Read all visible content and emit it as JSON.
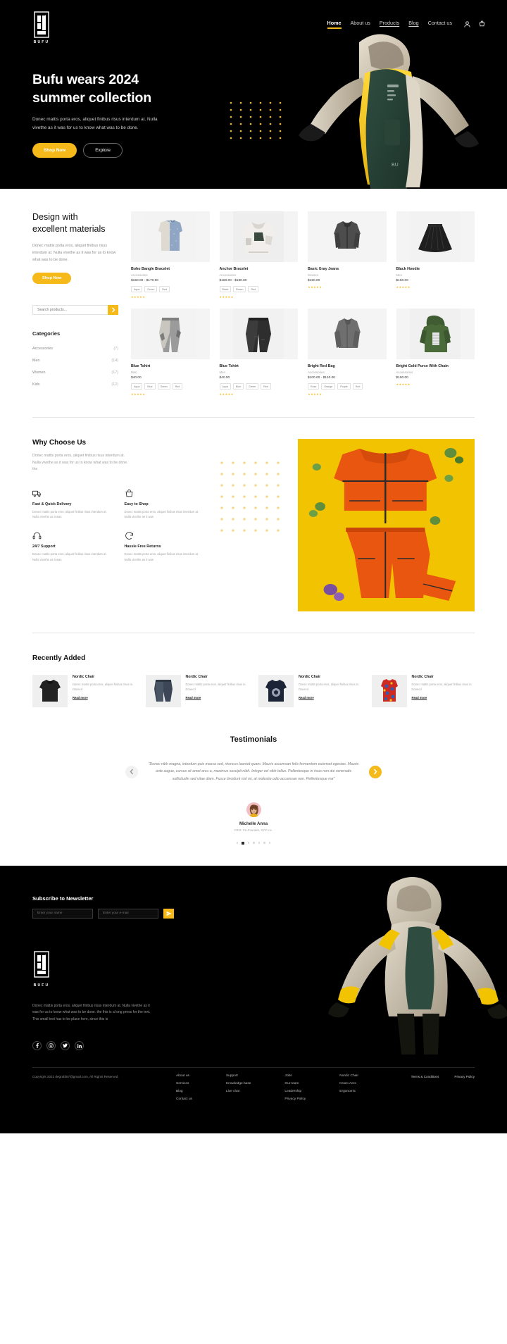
{
  "brand": {
    "name": "BUFU",
    "logo_icon": "bufu-monogram-logo"
  },
  "colors": {
    "accent": "#F5B919",
    "dark": "#000000",
    "muted": "#9a9a9a"
  },
  "nav": {
    "links": [
      {
        "label": "Home",
        "state": "active"
      },
      {
        "label": "About us",
        "state": "default"
      },
      {
        "label": "Products",
        "state": "underlined"
      },
      {
        "label": "Blog",
        "state": "underlined"
      },
      {
        "label": "Contact us",
        "state": "default"
      }
    ],
    "icons": [
      {
        "name": "user-account-icon"
      },
      {
        "name": "shopping-cart-icon"
      }
    ]
  },
  "hero": {
    "title_line1": "Bufu wears 2024",
    "title_line2": "summer collection",
    "subtitle": "Donec mattis porta eros, aliquet finibus risus interdum at. Nulla vivethe as it was for us to know what was to be done.",
    "primary_button": "Shop Now",
    "secondary_button": "Explore",
    "art_icon": "model-wearing-green-yellow-hooded-vest"
  },
  "design": {
    "title_line1": "Design with",
    "title_line2": "excellent materials",
    "copy": "Donec mattis porta eros, aliquet finibus risus interdum at. Nulla vivethe as it was for us to know what was to be done.",
    "shop_button": "Shop Now",
    "search_placeholder": "Search products...",
    "search_value": "",
    "search_icon": "chevron-right-icon",
    "categories_title": "Categories",
    "categories": [
      {
        "label": "Accessories",
        "count": "(7)"
      },
      {
        "label": "Men",
        "count": "(14)"
      },
      {
        "label": "Women",
        "count": "(17)"
      },
      {
        "label": "Kids",
        "count": "(12)"
      }
    ]
  },
  "products": [
    {
      "name": "Boho Bangle Bracelet",
      "category": "Accessories",
      "price": "$150.00 - $170.00",
      "swatches": [
        "Aqua",
        "Green",
        "Red"
      ],
      "rating": "★★★★★",
      "image_icon": "blue-grey-sleeveless-vest"
    },
    {
      "name": "Anchor Bracelet",
      "category": "Accessories",
      "price": "$150.00 - $180.00",
      "swatches": [
        "Black",
        "Brown",
        "Red"
      ],
      "rating": "★★★★★",
      "image_icon": "white-patched-jacket"
    },
    {
      "name": "Basic Gray Jeans",
      "category": "Women",
      "price": "$150.00",
      "swatches": [],
      "rating": "★★★★★",
      "image_icon": "grey-cropped-jacket"
    },
    {
      "name": "Black Hoodie",
      "category": "Men",
      "price": "$150.00",
      "swatches": [],
      "rating": "★★★★★",
      "image_icon": "black-pleated-skirt"
    },
    {
      "name": "Blue Tshirt",
      "category": "Men",
      "price": "$40.00",
      "swatches": [
        "Aqua",
        "Blue",
        "Green",
        "Red"
      ],
      "rating": "★★★★★",
      "image_icon": "grey-cargo-pants"
    },
    {
      "name": "Blue Tshirt",
      "category": "Men",
      "price": "$40.00",
      "swatches": [
        "Aqua",
        "Blue",
        "Green",
        "Red"
      ],
      "rating": "★★★★★",
      "image_icon": "black-wide-leg-trousers"
    },
    {
      "name": "Bright Red Bag",
      "category": "Accessories",
      "price": "$100.00 - $140.00",
      "swatches": [
        "Rose",
        "Orange",
        "Purple",
        "Red"
      ],
      "rating": "★★★★★",
      "image_icon": "grey-structured-jacket"
    },
    {
      "name": "Bright Gold Purse With Chain",
      "category": "Accessories",
      "price": "$150.00",
      "swatches": [],
      "rating": "★★★★★",
      "image_icon": "green-hooded-puffer-jacket"
    }
  ],
  "why": {
    "title": "Why Choose Us",
    "copy": "Donec mattis porta eros, aliquet finibus risus interdum at. Nulla vivethe as it was for us to know what was to be done. the",
    "features": [
      {
        "title": "Fast  & Quick Delivery",
        "copy": "Donec mattis porta eros, aliquet finibus risus interdum at. Nulla vivethe as it was",
        "icon": "delivery-truck-icon"
      },
      {
        "title": "Easy to Shop",
        "copy": "Donec mattis porta eros, aliquet finibus risus interdum at. Nulla vivethe as it was",
        "icon": "shopping-bag-icon"
      },
      {
        "title": "24/7 Support",
        "copy": "Donec mattis porta eros, aliquet finibus risus interdum at. Nulla vivethe as it was",
        "icon": "headset-support-icon"
      },
      {
        "title": "Hassle Free Returns",
        "copy": "Donec mattis porta eros, aliquet finibus risus interdum at. Nulla vivethe as it was",
        "icon": "return-arrow-icon"
      }
    ],
    "photo_icon": "orange-tracksuit-on-yellow-background"
  },
  "recent": {
    "title": "Recently Added",
    "items": [
      {
        "name": "Nordic Chair",
        "copy": "Donec mattis porta eros, aliquet finibus risus in. Donecd",
        "link": "Read more",
        "image_icon": "black-tshirt"
      },
      {
        "name": "Nordic Chair",
        "copy": "Donec mattis porta eros, aliquet finibus risus in. Donecd",
        "link": "Read more",
        "image_icon": "denim-shorts"
      },
      {
        "name": "Nordic Chair",
        "copy": "Donec mattis porta eros, aliquet finibus risus in. Donecd",
        "link": "Read more",
        "image_icon": "navy-graphic-tshirt"
      },
      {
        "name": "Nordic Chair",
        "copy": "Donec mattis porta eros, aliquet finibus risus in. Donecd",
        "link": "Read more",
        "image_icon": "red-blue-patterned-tank-top"
      }
    ]
  },
  "testimonials": {
    "title": "Testimonials",
    "quote": "\"Donec nibh magna, interdum quis massa sed, rhoncus laoreet quam. Mauris accumsan felis fermentum euismod egestas. Mauris ante augue, cursus sit amet arcu a, maximus suscipit nibh. Integer vel nibh tellus. Pellentesque in risus non dui venenatis sollicitudin sed vitae diam. Fusce tincidunt nisl mi, at molestie odio accumsan non. Pellentesque ma\"",
    "author_name": "Michelle Anna",
    "author_role": "CEO, Co-Founder, XYZ Inc.",
    "prev_icon": "chevron-left-icon",
    "next_icon": "chevron-right-icon",
    "avatar_icon": "woman-portrait-avatar",
    "dots_total": 7,
    "dots_active_index": 1
  },
  "footer": {
    "newsletter_title": "Subscribe to Newsletter",
    "name_placeholder": "Enter your name",
    "email_placeholder": "Enter your e-mail",
    "submit_icon": "send-paper-plane-icon",
    "description": "Donec mattis porta eros, aliquet finibus risus interdum at. Nulla vivethe as it was for us to know what was to be done. the this is a long press for the text. This small text has to be place here, since this is",
    "columns": [
      {
        "links": [
          "About us",
          "Services",
          "Blog",
          "Contact us"
        ]
      },
      {
        "links": [
          "Support",
          "Knowledge base",
          "Live chat"
        ]
      },
      {
        "links": [
          "Jobs",
          "Our team",
          "Leadership",
          "Privacy Policy"
        ]
      },
      {
        "links": [
          "Nordic Chair",
          "Kruzo Aero",
          "Ergonomic"
        ]
      }
    ],
    "socials": [
      {
        "name": "facebook-icon"
      },
      {
        "name": "instagram-icon"
      },
      {
        "name": "twitter-icon"
      },
      {
        "name": "linkedin-icon"
      }
    ],
    "copyright": "Copyright 2022 degrafd87@gmail.com, All Rights Reserved.",
    "legal": [
      "Terms & Conditions",
      "Privacy Policy"
    ],
    "art_icon": "model-back-view-hooded-jacket"
  }
}
